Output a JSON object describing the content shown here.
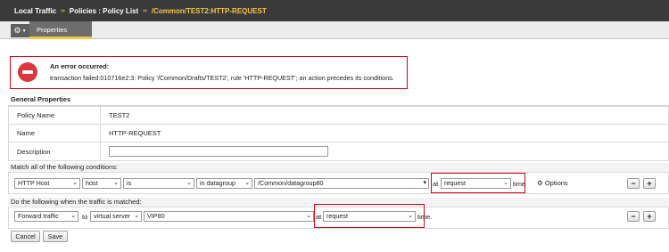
{
  "breadcrumb": {
    "items": [
      "Local Traffic",
      "Policies : Policy List"
    ],
    "separator": "››",
    "current": "/Common/TEST2:HTTP-REQUEST"
  },
  "tabs": {
    "gear_icon": "⚙",
    "caret_icon": "▼",
    "properties_label": "Properties"
  },
  "error": {
    "title": "An error occurred:",
    "message": "transaction failed:010716e2:3: Policy '/Common/Drafts/TEST2', rule 'HTTP-REQUEST'; an action precedes its conditions."
  },
  "general_properties": {
    "header": "General Properties",
    "rows": [
      {
        "label": "Policy Name",
        "value": "TEST2"
      },
      {
        "label": "Name",
        "value": "HTTP-REQUEST"
      },
      {
        "label": "Description",
        "value": ""
      }
    ]
  },
  "conditions": {
    "header": "Match all of the following conditions:",
    "row": {
      "operand": "HTTP Host",
      "selector": "host",
      "operator": "is",
      "match_type": "in datagroup",
      "datagroup": "/Common/datagroup80",
      "at_label": "at",
      "event": "request",
      "time_label": "time",
      "options_icon": "⚙",
      "options_label": "Options",
      "minus_label": "−",
      "plus_label": "+"
    }
  },
  "actions": {
    "header": "Do the following when the traffic is matched:",
    "row": {
      "action": "Forward traffic",
      "to_label": "to",
      "target_type": "virtual server",
      "target": "VIP80",
      "at_label": "at",
      "event": "request",
      "time_label": "time.",
      "minus_label": "−",
      "plus_label": "+"
    }
  },
  "buttons": {
    "cancel": "Cancel",
    "save": "Save"
  },
  "colors": {
    "highlight": "#d0021b",
    "accent": "#f2c744",
    "header_bg": "#3a3a3a"
  }
}
